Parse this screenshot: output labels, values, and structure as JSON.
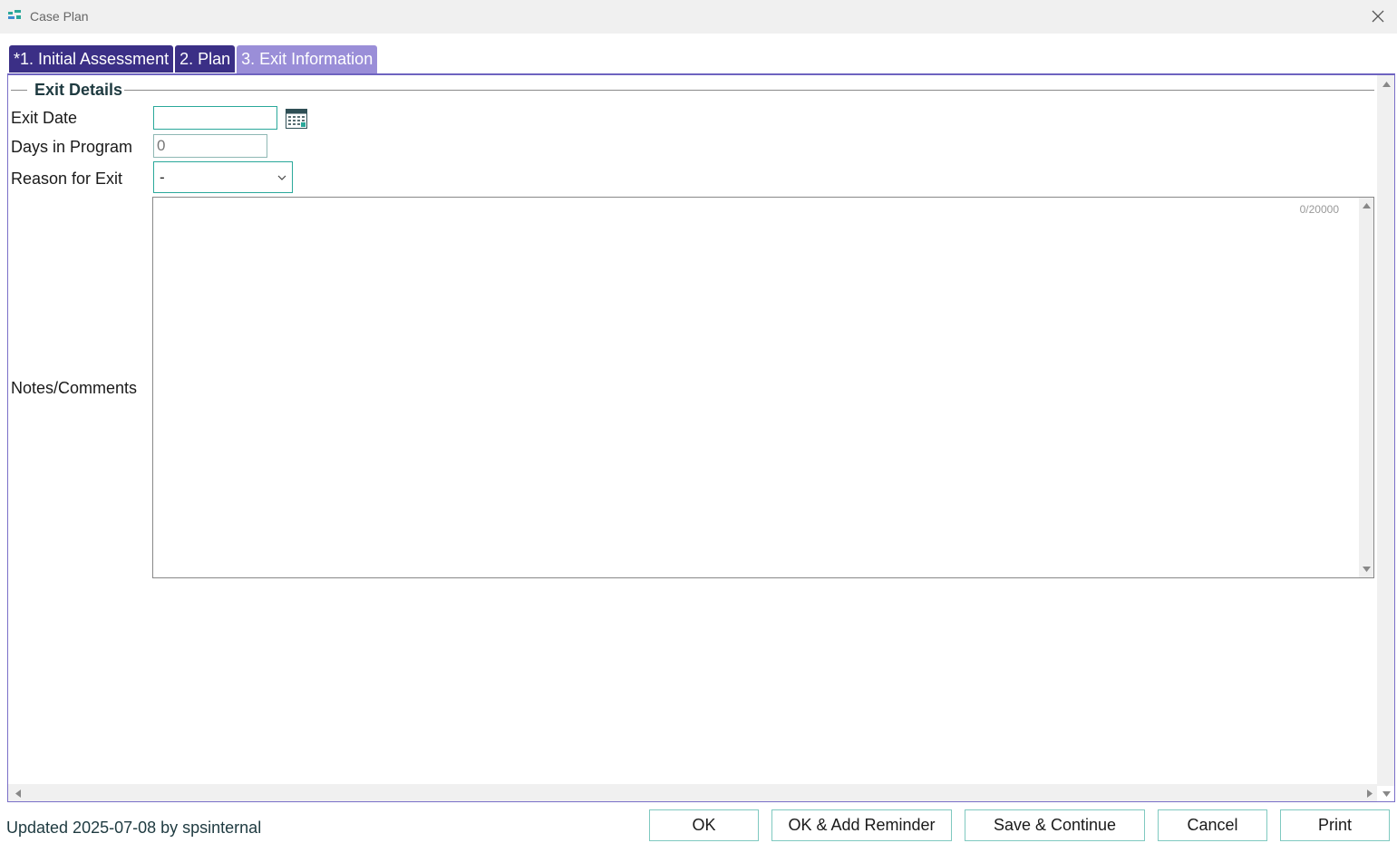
{
  "window": {
    "title": "Case Plan"
  },
  "tabs": [
    {
      "label": "*1. Initial Assessment",
      "active": false
    },
    {
      "label": "2. Plan",
      "active": false
    },
    {
      "label": "3. Exit Information",
      "active": true
    }
  ],
  "section": {
    "title": "Exit Details"
  },
  "form": {
    "exit_date": {
      "label": "Exit Date",
      "value": ""
    },
    "days_in_program": {
      "label": "Days in Program",
      "value": "0"
    },
    "reason_for_exit": {
      "label": "Reason for Exit",
      "value": "-"
    },
    "notes": {
      "label": "Notes/Comments",
      "value": "",
      "counter": "0/20000"
    }
  },
  "footer": {
    "status": "Updated 2025-07-08 by spsinternal",
    "buttons": {
      "ok": "OK",
      "ok_add_reminder": "OK & Add Reminder",
      "save_continue": "Save & Continue",
      "cancel": "Cancel",
      "print": "Print"
    }
  },
  "colors": {
    "tab_dark": "#3b2f86",
    "tab_active": "#9a8ed8",
    "input_border": "#2aa89a",
    "heading_text": "#1e3a40"
  },
  "icons": {
    "app": "app-logo-icon",
    "close": "close-icon",
    "calendar": "calendar-icon",
    "dropdown": "chevron-down-icon"
  }
}
